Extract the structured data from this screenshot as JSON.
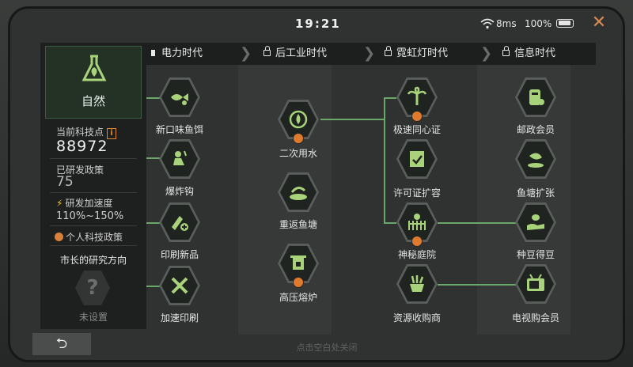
{
  "status": {
    "time": "19:21",
    "ping": "8ms",
    "battery": "100%"
  },
  "eras": [
    {
      "label": "电力时代",
      "locked": false
    },
    {
      "label": "后工业时代",
      "locked": true
    },
    {
      "label": "霓虹灯时代",
      "locked": true
    },
    {
      "label": "信息时代",
      "locked": true
    }
  ],
  "sidebar": {
    "category": "自然",
    "points_label": "当前科技点",
    "points_value": "88972",
    "researched_label": "已研发政策",
    "researched_value": "75",
    "speed_label": "研发加速度",
    "speed_value": "110%~150%",
    "personal_label": "个人科技政策",
    "direction_title": "市长的研究方向",
    "unset_label": "未设置"
  },
  "nodes": {
    "n1": "新口味鱼饵",
    "n2": "爆炸钩",
    "n3": "印刷新品",
    "n4": "加速印刷",
    "n5": "二次用水",
    "n6": "重返鱼塘",
    "n7": "高压熔炉",
    "n8": "极速同心证",
    "n9": "许可证扩容",
    "n10": "神秘庭院",
    "n11": "资源收购商",
    "n12": "邮政会员",
    "n13": "鱼塘扩张",
    "n14": "种豆得豆",
    "n15": "电视购会员"
  },
  "bottom_hint": "点击空白处关闭",
  "colors": {
    "accent_green": "#6aa86a",
    "badge_orange": "#e07b2e",
    "close_orange": "#d98a52"
  }
}
